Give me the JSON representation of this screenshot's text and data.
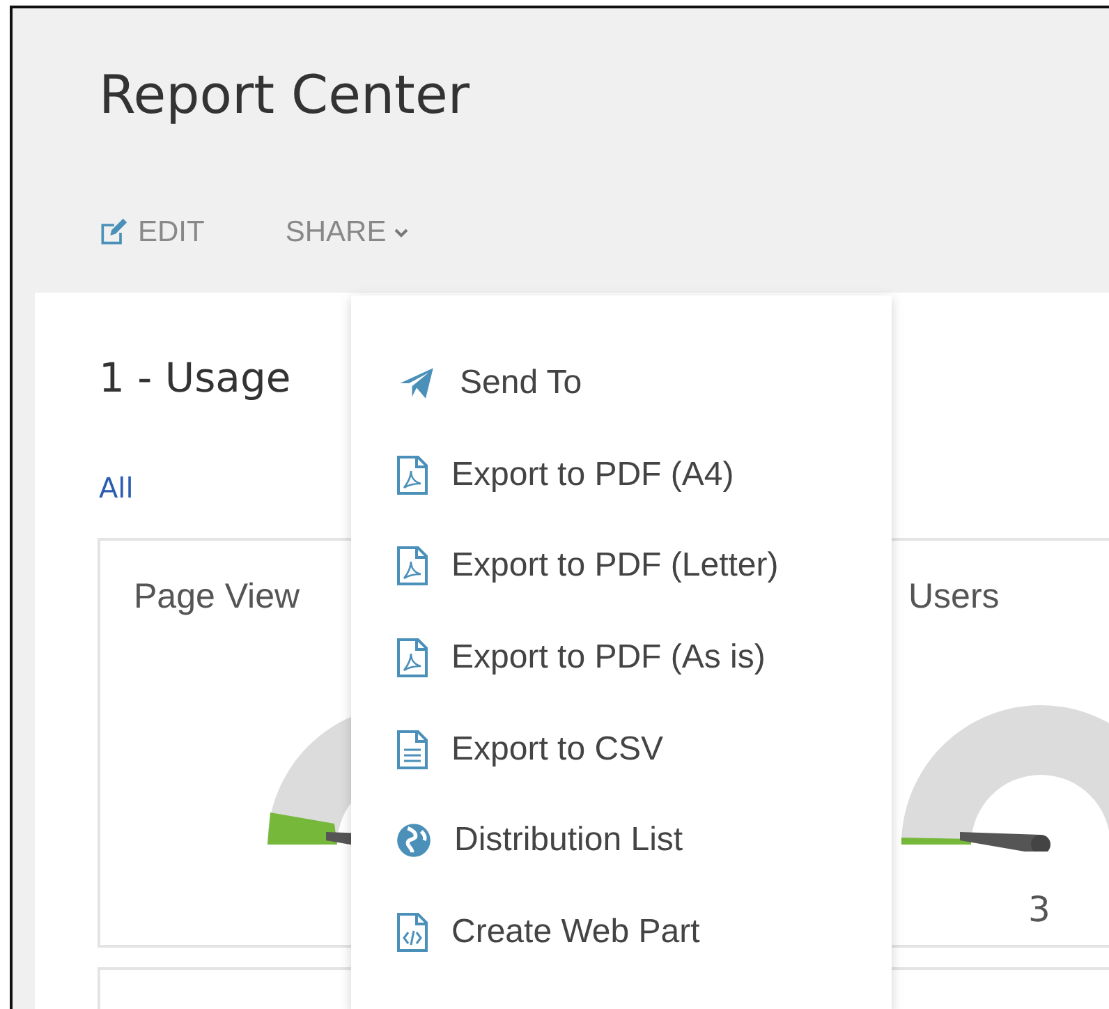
{
  "page": {
    "title": "Report Center"
  },
  "toolbar": [
    {
      "kind": "edit",
      "label": "EDIT"
    },
    {
      "kind": "share",
      "label": "SHARE",
      "expanded": true
    }
  ],
  "section": {
    "title": "1 - Usage",
    "filter_link": "All"
  },
  "cards": [
    {
      "title": "Page View"
    },
    {
      "title": "Users",
      "value": "3"
    }
  ],
  "share_menu": [
    {
      "kind": "send",
      "label": "Send To"
    },
    {
      "kind": "pdf",
      "label": "Export to PDF (A4)"
    },
    {
      "kind": "pdf",
      "label": "Export to PDF (Letter)"
    },
    {
      "kind": "pdf",
      "label": "Export to PDF (As is)"
    },
    {
      "kind": "csv",
      "label": "Export to CSV"
    },
    {
      "kind": "distribution",
      "label": "Distribution List"
    },
    {
      "kind": "webpart",
      "label": "Create Web Part"
    }
  ]
}
